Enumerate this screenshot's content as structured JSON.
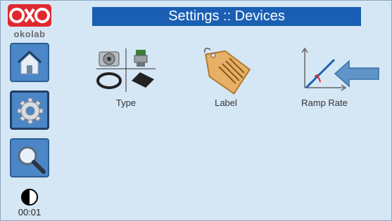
{
  "header": {
    "title": "Settings :: Devices"
  },
  "sidebar": {
    "logo_text": "okolab",
    "items": [
      {
        "name": "home",
        "icon": "home-icon"
      },
      {
        "name": "settings",
        "icon": "gear-icon",
        "active": true
      },
      {
        "name": "search",
        "icon": "magnifier-icon"
      }
    ],
    "contrast_icon": "contrast-icon",
    "timer": "00:01"
  },
  "tiles": [
    {
      "label": "Type",
      "icon": "connector-type-icon"
    },
    {
      "label": "Label",
      "icon": "tag-icon"
    },
    {
      "label": "Ramp Rate",
      "icon": "ramp-rate-icon"
    }
  ],
  "colors": {
    "title_bar": "#1a5fb4",
    "nav_button": "#4b86c6",
    "background": "#d5e6f5",
    "logo_red": "#e0282e",
    "arrow_blue": "#5f94c8"
  }
}
